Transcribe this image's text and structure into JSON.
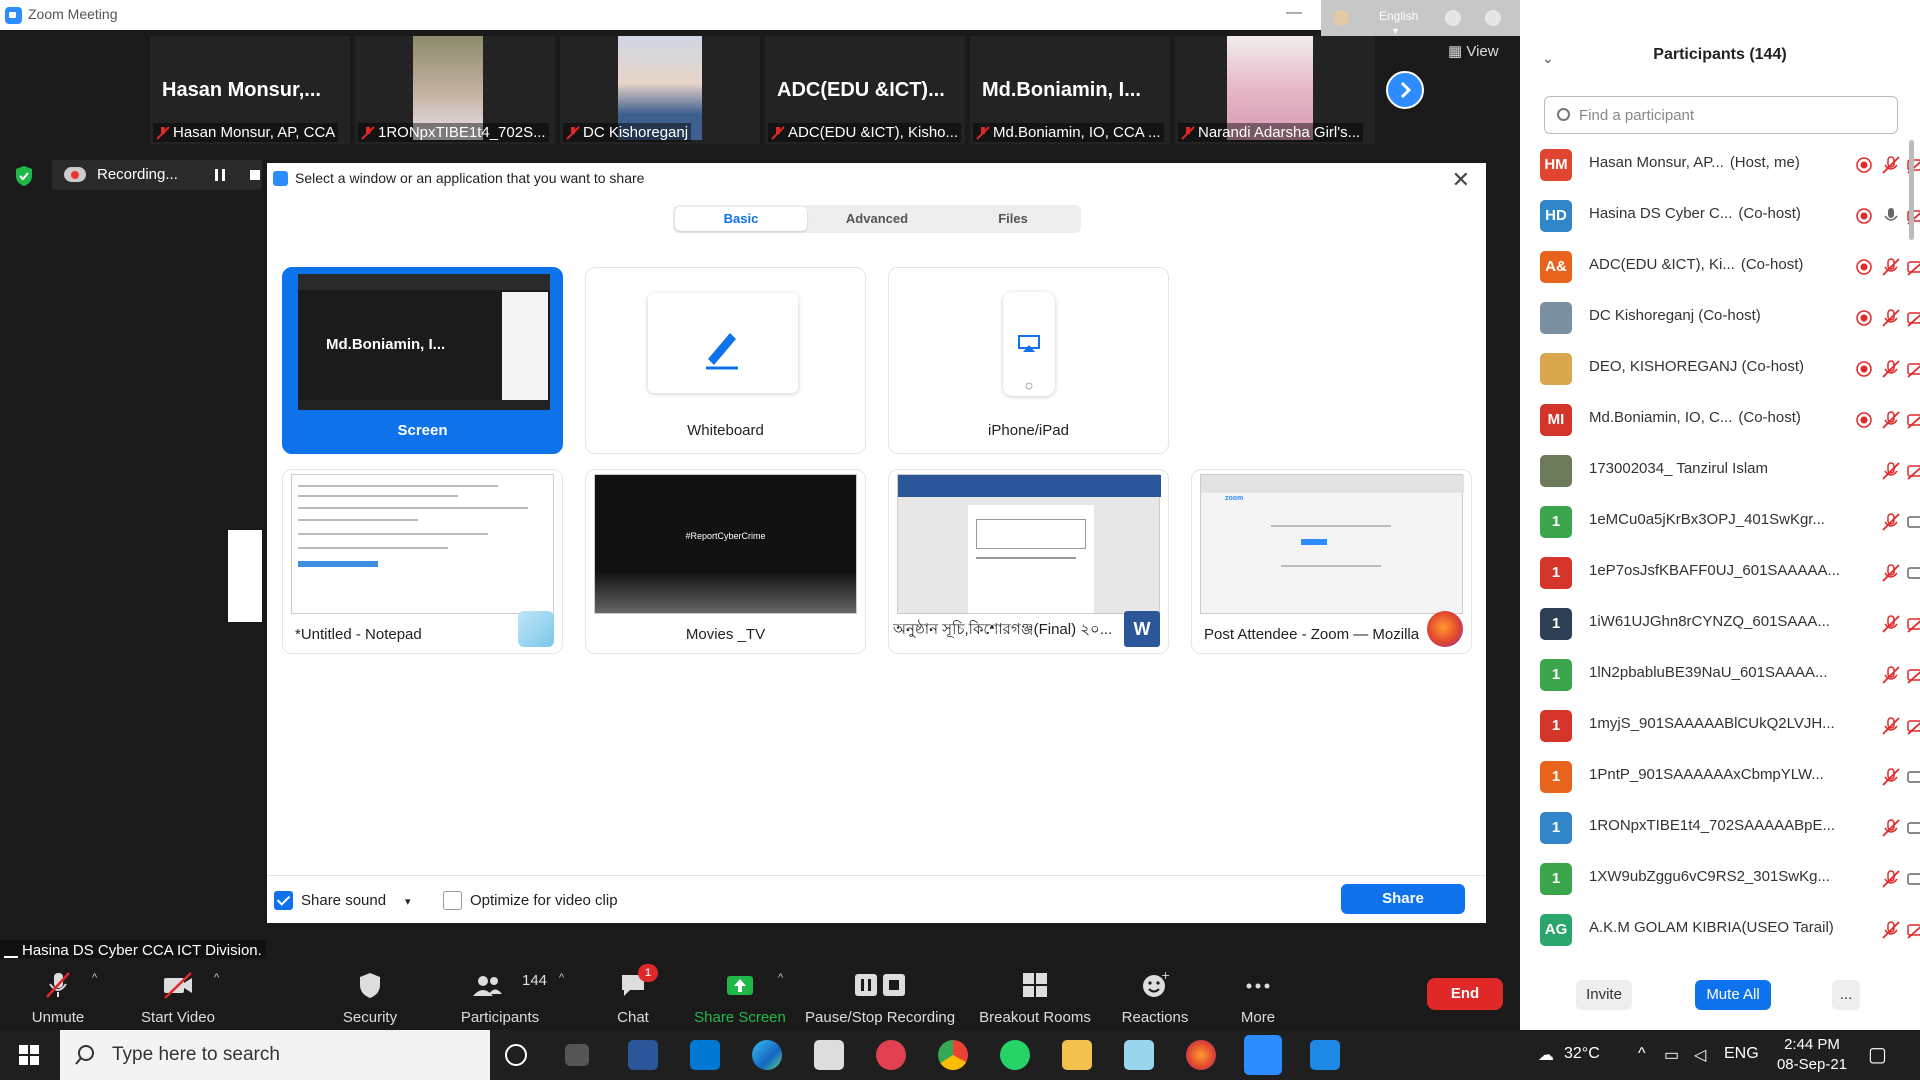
{
  "window": {
    "title": "Zoom Meeting"
  },
  "top_strip": {
    "language": "English"
  },
  "gallery": {
    "tiles": [
      {
        "big_name": "Hasan  Monsur,...",
        "label": "Hasan Monsur, AP, CCA"
      },
      {
        "big_name": "",
        "label": "1RONpxTIBE1t4_702S..."
      },
      {
        "big_name": "",
        "label": "DC Kishoreganj"
      },
      {
        "big_name": "ADC(EDU  &ICT)...",
        "label": "ADC(EDU &ICT), Kisho..."
      },
      {
        "big_name": "Md.Boniamin,  I...",
        "label": "Md.Boniamin, IO, CCA ..."
      },
      {
        "big_name": "",
        "label": "Narandi Adarsha Girl's..."
      }
    ],
    "view_label": "View"
  },
  "recording": {
    "label": "Recording..."
  },
  "share_dialog": {
    "title": "Select a window or an application that you want to share",
    "tabs": [
      "Basic",
      "Advanced",
      "Files"
    ],
    "options": [
      {
        "label": "Screen",
        "thumb_text": "Md.Boniamin,  I..."
      },
      {
        "label": "Whiteboard"
      },
      {
        "label": "iPhone/iPad"
      }
    ],
    "windows": [
      {
        "label": "*Untitled - Notepad",
        "icon": "notepad-icon"
      },
      {
        "label": "Movies _TV",
        "thumb_text": "#ReportCyberCrime",
        "icon": ""
      },
      {
        "label": "অনুষ্ঠান সূচি,কিশোরগঞ্জ(Final) ২০...",
        "icon": "word-icon"
      },
      {
        "label": "Post Attendee - Zoom — Mozilla ...",
        "thumb_text": "zoom",
        "icon": "firefox-icon"
      }
    ],
    "share_sound_label": "Share sound",
    "share_sound_checked": true,
    "optimize_label": "Optimize for video clip",
    "optimize_checked": false,
    "share_button": "Share"
  },
  "active_speaker": "Hasina DS Cyber CCA ICT Division.",
  "toolbar": {
    "unmute": "Unmute",
    "start_video": "Start Video",
    "security": "Security",
    "participants": "Participants",
    "participants_count": "144",
    "chat": "Chat",
    "chat_badge": "1",
    "share_screen": "Share Screen",
    "pause_stop_recording": "Pause/Stop Recording",
    "breakout_rooms": "Breakout Rooms",
    "reactions": "Reactions",
    "more": "More",
    "end": "End"
  },
  "participants_panel": {
    "header": "Participants (144)",
    "search_placeholder": "Find a participant",
    "participants": [
      {
        "initials": "HM",
        "avatar_color": "#e0452f",
        "name": "Hasan Monsur, AP...",
        "role": "(Host, me)",
        "recording": true,
        "mic_muted": true,
        "video_off": true
      },
      {
        "initials": "HD",
        "avatar_color": "#2f86c8",
        "name": "Hasina DS Cyber C...",
        "role": "(Co-host)",
        "recording": true,
        "mic_muted": false,
        "video_off": true
      },
      {
        "initials": "A&",
        "avatar_color": "#e8641c",
        "name": "ADC(EDU &ICT), Ki...",
        "role": "(Co-host)",
        "recording": true,
        "mic_muted": true,
        "video_off": true
      },
      {
        "initials": "",
        "avatar_color": "#7a8f9f",
        "name": "DC Kishoreganj (Co-host)",
        "role": "",
        "recording": true,
        "mic_muted": true,
        "video_off": true
      },
      {
        "initials": "",
        "avatar_color": "#d9a84e",
        "name": "DEO, KISHOREGANJ (Co-host)",
        "role": "",
        "recording": true,
        "mic_muted": true,
        "video_off": true
      },
      {
        "initials": "MI",
        "avatar_color": "#d5342b",
        "name": "Md.Boniamin, IO, C...",
        "role": "(Co-host)",
        "recording": true,
        "mic_muted": true,
        "video_off": true
      },
      {
        "initials": "",
        "avatar_color": "#6c7a5a",
        "name": "173002034_ Tanzirul Islam",
        "role": "",
        "recording": false,
        "mic_muted": true,
        "video_off": true
      },
      {
        "initials": "1",
        "avatar_color": "#3aa54b",
        "name": "1eMCu0a5jKrBx3OPJ_401SwKgr...",
        "role": "",
        "recording": false,
        "mic_muted": true,
        "video_off": false
      },
      {
        "initials": "1",
        "avatar_color": "#d5342b",
        "name": "1eP7osJsfKBAFF0UJ_601SAAAAA...",
        "role": "",
        "recording": false,
        "mic_muted": true,
        "video_off": false
      },
      {
        "initials": "1",
        "avatar_color": "#2d3f55",
        "name": "1iW61UJGhn8rCYNZQ_601SAAA...",
        "role": "",
        "recording": false,
        "mic_muted": true,
        "video_off": true
      },
      {
        "initials": "1",
        "avatar_color": "#3aa54b",
        "name": "1lN2pbabluBE39NaU_601SAAAA...",
        "role": "",
        "recording": false,
        "mic_muted": true,
        "video_off": true
      },
      {
        "initials": "1",
        "avatar_color": "#d5342b",
        "name": "1myjS_901SAAAAABlCUkQ2LVJH...",
        "role": "",
        "recording": false,
        "mic_muted": true,
        "video_off": true
      },
      {
        "initials": "1",
        "avatar_color": "#e8641c",
        "name": "1PntP_901SAAAAAAxCbmpYLW...",
        "role": "",
        "recording": false,
        "mic_muted": true,
        "video_off": false
      },
      {
        "initials": "1",
        "avatar_color": "#2f86c8",
        "name": "1RONpxTIBE1t4_702SAAAAABpE...",
        "role": "",
        "recording": false,
        "mic_muted": true,
        "video_off": false
      },
      {
        "initials": "1",
        "avatar_color": "#3aa54b",
        "name": "1XW9ubZggu6vC9RS2_301SwKg...",
        "role": "",
        "recording": false,
        "mic_muted": true,
        "video_off": false
      },
      {
        "initials": "AG",
        "avatar_color": "#2aa56b",
        "name": "A.K.M GOLAM KIBRIA(USEO Tarail)",
        "role": "",
        "recording": false,
        "mic_muted": true,
        "video_off": true
      }
    ],
    "invite": "Invite",
    "mute_all": "Mute All",
    "more": "..."
  },
  "taskbar": {
    "search_placeholder": "Type here to search",
    "temperature": "32°C",
    "language": "ENG",
    "time": "2:44 PM",
    "date": "08-Sep-21"
  },
  "colors": {
    "zoom_blue": "#0e72ed",
    "end_red": "#e02828",
    "share_green": "#21b84a",
    "mute_red": "#e02828"
  }
}
